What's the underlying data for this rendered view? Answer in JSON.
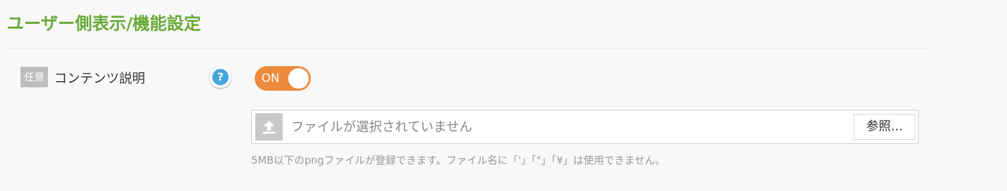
{
  "section": {
    "title": "ユーザー側表示/機能設定"
  },
  "field": {
    "badge": "任意",
    "label": "コンテンツ説明",
    "help_icon": "question-circle-icon",
    "help_symbol": "?",
    "toggle": {
      "state_label": "ON",
      "on": true
    }
  },
  "file_input": {
    "upload_icon": "upload-icon",
    "status_text": "ファイルが選択されていません",
    "browse_label": "参照..."
  },
  "hint": "5MB以下のpngファイルが登録できます。ファイル名に「'」「\"」「¥」は使用できません。",
  "colors": {
    "title_green": "#6aaa3a",
    "toggle_orange": "#ee8a3c",
    "help_blue": "#47a7dc",
    "badge_gray": "#bdbdbd"
  }
}
